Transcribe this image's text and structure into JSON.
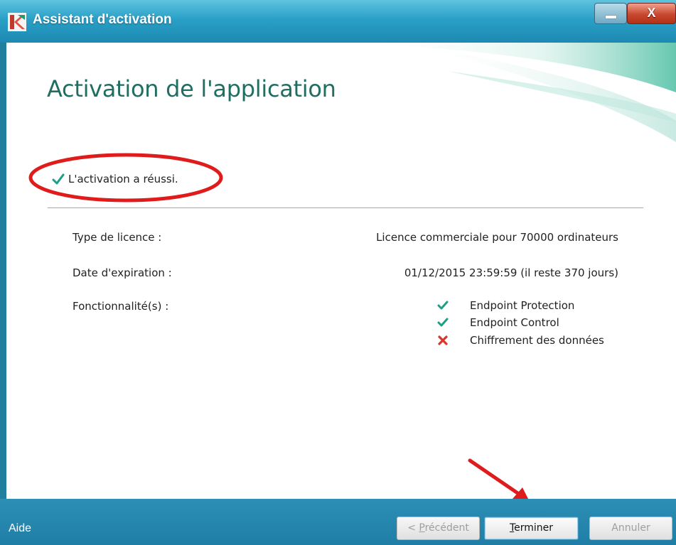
{
  "window": {
    "title": "Assistant d'activation",
    "minimize_glyph": "",
    "close_glyph": "X"
  },
  "main": {
    "heading": "Activation de l'application",
    "success_message": "L'activation a réussi.",
    "details": [
      {
        "label": "Type de licence :",
        "value": "Licence commerciale pour 70000 ordinateurs"
      },
      {
        "label": "Date d'expiration :",
        "value": "01/12/2015 23:59:59 (il reste 370 jours)"
      },
      {
        "label": "Fonctionnalité(s) :",
        "value": ""
      }
    ],
    "features": [
      {
        "name": "Endpoint Protection",
        "status": "enabled",
        "icon": "check-icon"
      },
      {
        "name": "Endpoint Control",
        "status": "enabled",
        "icon": "check-icon"
      },
      {
        "name": "Chiffrement des données",
        "status": "disabled",
        "icon": "cross-icon"
      }
    ]
  },
  "footer": {
    "help": "Aide",
    "prev_button": {
      "accel": "P",
      "before": "< ",
      "after": "récédent"
    },
    "finish_button": {
      "accel": "T",
      "after": "erminer"
    },
    "cancel_button": "Annuler"
  },
  "colors": {
    "titlebar": "#2aa0c7",
    "heading": "#1f6e61",
    "check": "#1f9e87",
    "cross": "#d9372a",
    "annotation": "#e01b1b"
  }
}
